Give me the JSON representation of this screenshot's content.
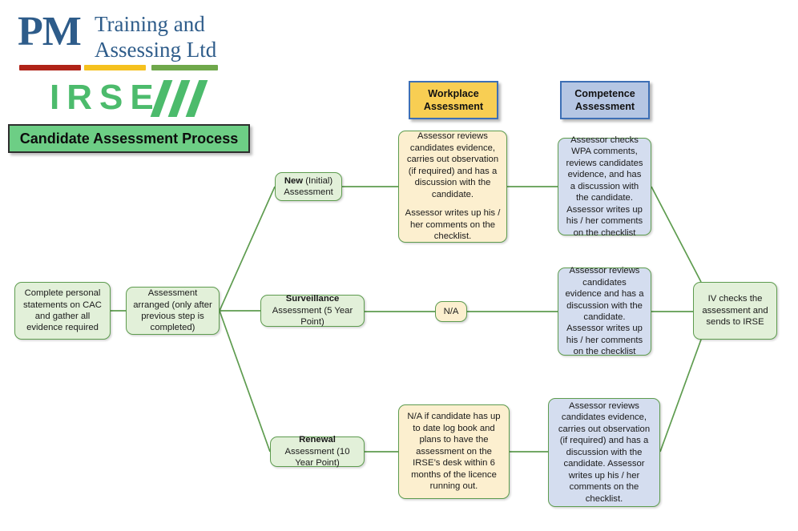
{
  "logo": {
    "pm_letters": "PM",
    "pm_line1": "Training and",
    "pm_line2": "Assessing Ltd",
    "irse_text": "IRSE",
    "rule_colors": [
      "#B02318",
      "#F5C11E",
      "#6FA84B"
    ]
  },
  "title": {
    "text": "Candidate Assessment Process",
    "background": "#6DCE85",
    "border": "#2E2E2E"
  },
  "headers": {
    "workplace": {
      "line1": "Workplace",
      "line2": "Assessment",
      "background": "#F8CE53",
      "border": "#3D6FB5"
    },
    "competence": {
      "line1": "Competence",
      "line2": "Assessment",
      "background": "#B5C6E3",
      "border": "#3D6FB5"
    }
  },
  "nodes": {
    "start": "Complete personal statements on CAC and gather all evidence required",
    "arranged": "Assessment arranged (only after previous step is completed)",
    "branch_new_strong": "New",
    "branch_new_rest": " (Initial) Assessment",
    "branch_surveillance_strong": "Surveillance",
    "branch_surveillance_rest": " Assessment (5 Year Point)",
    "branch_renewal_strong": "Renewal",
    "branch_renewal_rest": " Assessment (10 Year Point)",
    "wpa_new_p1": "Assessor reviews candidates evidence, carries out observation (if required) and has a discussion with the candidate.",
    "wpa_new_p2": "Assessor writes up his / her comments on the checklist.",
    "ca_new": "Assessor checks WPA comments, reviews candidates evidence, and has a discussion with the candidate. Assessor writes up his / her comments on the checklist",
    "wpa_surveillance": "N/A",
    "ca_surveillance": "Assessor reviews candidates evidence and has a discussion with the candidate. Assessor writes up his / her comments on the checklist",
    "wpa_renewal": "N/A if candidate has up to date log book and plans to have the assessment on the IRSE’s desk within 6 months of the licence running out.",
    "ca_renewal": "Assessor reviews candidates evidence, carries out observation (if required) and has a discussion with the candidate. Assessor writes up his / her comments on the checklist.",
    "iv": "IV checks the assessment and sends to IRSE"
  },
  "colors": {
    "connector": "#5E9C4F",
    "node_border": "#5E9C4F",
    "green_fill": "#E2F0D9",
    "yellow_fill": "#FCEFCF",
    "blue_fill": "#D4DDEF",
    "irse_green": "#4CBB6C",
    "pm_blue": "#2E5C8A"
  }
}
